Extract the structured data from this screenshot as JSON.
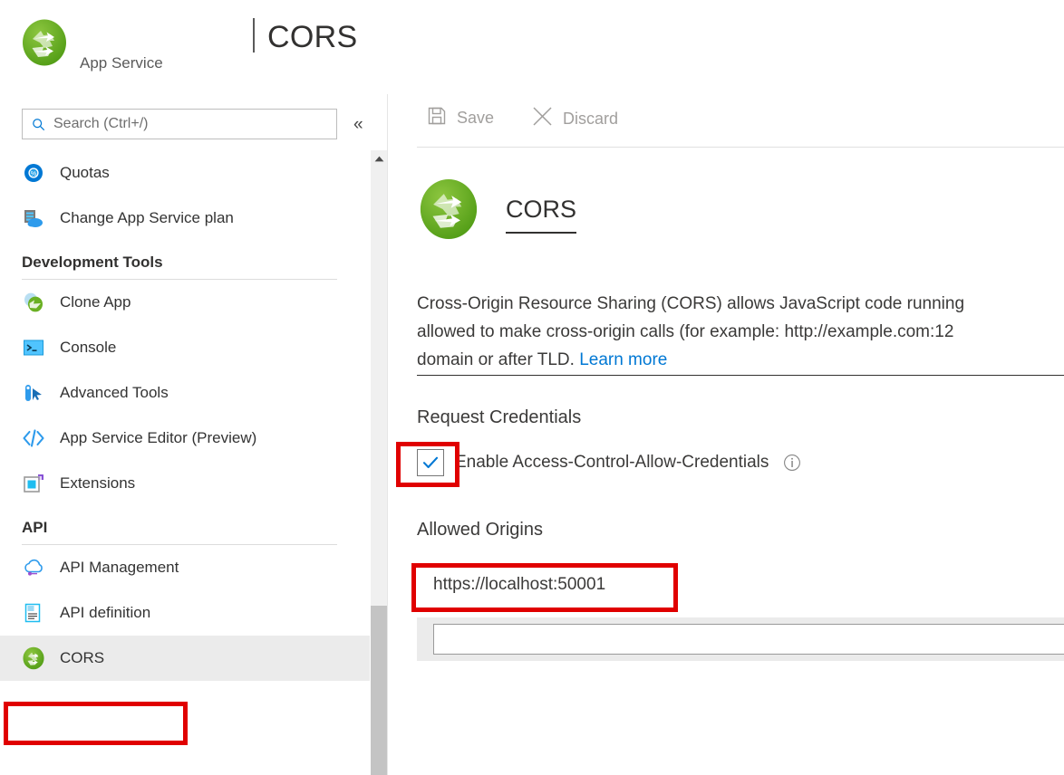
{
  "header": {
    "resource_name": " ",
    "resource_type": "App Service",
    "title_separator": "|",
    "title": "CORS",
    "logo_icon": "app-service-cors-logo"
  },
  "sidebar": {
    "search": {
      "placeholder": "Search (Ctrl+/)",
      "value": "",
      "icon": "search-icon"
    },
    "collapse_label": "«",
    "scroll_up_icon": "chevron-up-icon",
    "items": [
      {
        "label": "Quotas",
        "icon": "quotas-icon",
        "type": "item",
        "selected": false
      },
      {
        "label": "Change App Service plan",
        "icon": "app-service-plan-icon",
        "type": "item",
        "selected": false
      },
      {
        "label": "Development Tools",
        "icon": "",
        "type": "group",
        "selected": false
      },
      {
        "label": "Clone App",
        "icon": "clone-app-icon",
        "type": "item",
        "selected": false
      },
      {
        "label": "Console",
        "icon": "console-icon",
        "type": "item",
        "selected": false
      },
      {
        "label": "Advanced Tools",
        "icon": "advanced-tools-icon",
        "type": "item",
        "selected": false
      },
      {
        "label": "App Service Editor (Preview)",
        "icon": "code-editor-icon",
        "type": "item",
        "selected": false
      },
      {
        "label": "Extensions",
        "icon": "extensions-icon",
        "type": "item",
        "selected": false
      },
      {
        "label": "API",
        "icon": "",
        "type": "group",
        "selected": false
      },
      {
        "label": "API Management",
        "icon": "api-management-icon",
        "type": "item",
        "selected": false
      },
      {
        "label": "API definition",
        "icon": "api-definition-icon",
        "type": "item",
        "selected": false
      },
      {
        "label": "CORS",
        "icon": "cors-icon",
        "type": "item",
        "selected": true
      }
    ]
  },
  "content": {
    "commands": [
      {
        "label": "Save",
        "icon": "save-icon",
        "enabled": false
      },
      {
        "label": "Discard",
        "icon": "discard-icon",
        "enabled": false
      }
    ],
    "section": {
      "title": "CORS",
      "logo_icon": "cors-logo"
    },
    "description": {
      "line1": "Cross-Origin Resource Sharing (CORS) allows JavaScript code running",
      "line2": "allowed to make cross-origin calls (for example: http://example.com:12",
      "line3_prefix": "domain or after TLD. ",
      "link_label": "Learn more"
    },
    "request_credentials": {
      "heading": "Request Credentials",
      "checkbox_label": "Enable Access-Control-Allow-Credentials",
      "checked": true,
      "info_icon": "info-icon"
    },
    "allowed_origins": {
      "heading": "Allowed Origins",
      "existing_value": "https://localhost:50001",
      "new_value": "",
      "new_placeholder": ""
    }
  },
  "annotations": {
    "accent_color": "#e00000",
    "boxes": [
      {
        "name": "sidebar-cors-highlight"
      },
      {
        "name": "enable-credentials-checkbox-highlight"
      },
      {
        "name": "allowed-origin-value-highlight"
      }
    ]
  },
  "colors": {
    "link": "#0078d4",
    "accent_green": "#5aa72a",
    "selected_row": "#ebebeb",
    "annotation_red": "#e00000"
  }
}
